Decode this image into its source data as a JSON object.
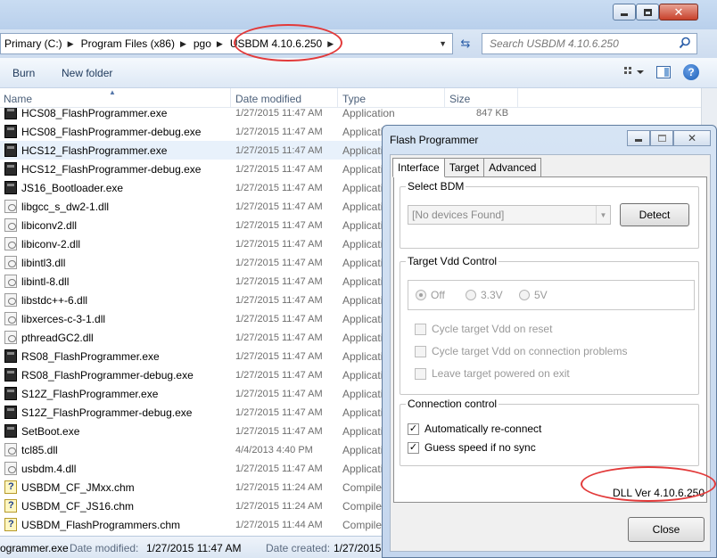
{
  "address": {
    "crumbs": [
      "Primary (C:)",
      "Program Files (x86)",
      "pgo",
      "USBDM 4.10.6.250"
    ],
    "search_placeholder": "Search USBDM 4.10.6.250"
  },
  "toolbar": {
    "burn": "Burn",
    "new_folder": "New folder"
  },
  "columns": {
    "name": "Name",
    "date": "Date modified",
    "type": "Type",
    "size": "Size"
  },
  "files": [
    {
      "name": "HCS08_FlashProgrammer.exe",
      "date": "1/27/2015 11:47 AM",
      "type": "Application",
      "size": "847 KB",
      "icon": "exe-icon"
    },
    {
      "name": "HCS08_FlashProgrammer-debug.exe",
      "date": "1/27/2015 11:47 AM",
      "type": "Applicati",
      "size": "",
      "icon": "exe-icon"
    },
    {
      "name": "HCS12_FlashProgrammer.exe",
      "date": "1/27/2015 11:47 AM",
      "type": "Applicati",
      "size": "",
      "icon": "exe-icon"
    },
    {
      "name": "HCS12_FlashProgrammer-debug.exe",
      "date": "1/27/2015 11:47 AM",
      "type": "Applicati",
      "size": "",
      "icon": "exe-icon"
    },
    {
      "name": "JS16_Bootloader.exe",
      "date": "1/27/2015 11:47 AM",
      "type": "Applicati",
      "size": "",
      "icon": "exe-icon"
    },
    {
      "name": "libgcc_s_dw2-1.dll",
      "date": "1/27/2015 11:47 AM",
      "type": "Applicati",
      "size": "",
      "icon": "dll-icon"
    },
    {
      "name": "libiconv2.dll",
      "date": "1/27/2015 11:47 AM",
      "type": "Applicati",
      "size": "",
      "icon": "dll-icon"
    },
    {
      "name": "libiconv-2.dll",
      "date": "1/27/2015 11:47 AM",
      "type": "Applicati",
      "size": "",
      "icon": "dll-icon"
    },
    {
      "name": "libintl3.dll",
      "date": "1/27/2015 11:47 AM",
      "type": "Applicati",
      "size": "",
      "icon": "dll-icon"
    },
    {
      "name": "libintl-8.dll",
      "date": "1/27/2015 11:47 AM",
      "type": "Applicati",
      "size": "",
      "icon": "dll-icon"
    },
    {
      "name": "libstdc++-6.dll",
      "date": "1/27/2015 11:47 AM",
      "type": "Applicati",
      "size": "",
      "icon": "dll-icon"
    },
    {
      "name": "libxerces-c-3-1.dll",
      "date": "1/27/2015 11:47 AM",
      "type": "Applicati",
      "size": "",
      "icon": "dll-icon"
    },
    {
      "name": "pthreadGC2.dll",
      "date": "1/27/2015 11:47 AM",
      "type": "Applicati",
      "size": "",
      "icon": "dll-icon"
    },
    {
      "name": "RS08_FlashProgrammer.exe",
      "date": "1/27/2015 11:47 AM",
      "type": "Applicati",
      "size": "",
      "icon": "exe-icon"
    },
    {
      "name": "RS08_FlashProgrammer-debug.exe",
      "date": "1/27/2015 11:47 AM",
      "type": "Applicati",
      "size": "",
      "icon": "exe-icon"
    },
    {
      "name": "S12Z_FlashProgrammer.exe",
      "date": "1/27/2015 11:47 AM",
      "type": "Applicati",
      "size": "",
      "icon": "exe-icon"
    },
    {
      "name": "S12Z_FlashProgrammer-debug.exe",
      "date": "1/27/2015 11:47 AM",
      "type": "Applicati",
      "size": "",
      "icon": "exe-icon"
    },
    {
      "name": "SetBoot.exe",
      "date": "1/27/2015 11:47 AM",
      "type": "Applicati",
      "size": "",
      "icon": "exe-icon"
    },
    {
      "name": "tcl85.dll",
      "date": "4/4/2013 4:40 PM",
      "type": "Applicati",
      "size": "",
      "icon": "dll-icon"
    },
    {
      "name": "usbdm.4.dll",
      "date": "1/27/2015 11:47 AM",
      "type": "Applicati",
      "size": "",
      "icon": "dll-icon"
    },
    {
      "name": "USBDM_CF_JMxx.chm",
      "date": "1/27/2015 11:24 AM",
      "type": "Compile",
      "size": "",
      "icon": "chm-icon"
    },
    {
      "name": "USBDM_CF_JS16.chm",
      "date": "1/27/2015 11:24 AM",
      "type": "Compile",
      "size": "",
      "icon": "chm-icon"
    },
    {
      "name": "USBDM_FlashProgrammers.chm",
      "date": "1/27/2015 11:44 AM",
      "type": "Compile",
      "size": "",
      "icon": "chm-icon"
    }
  ],
  "details": {
    "name": "ogrammer.exe",
    "modified_label": "Date modified:",
    "modified_value": "1/27/2015 11:47 AM",
    "created_label": "Date created:",
    "created_value": "1/27/2015"
  },
  "dialog": {
    "title": "Flash Programmer",
    "tabs": [
      "Interface",
      "Target",
      "Advanced"
    ],
    "select_bdm": {
      "label": "Select BDM",
      "combo_value": "[No devices Found]",
      "detect_button": "Detect"
    },
    "vdd": {
      "label": "Target Vdd Control",
      "options": [
        "Off",
        "3.3V",
        "5V"
      ],
      "selected": "Off",
      "checks": [
        "Cycle target Vdd on reset",
        "Cycle target Vdd on connection problems",
        "Leave target powered on exit"
      ]
    },
    "connection": {
      "label": "Connection control",
      "checks": [
        {
          "label": "Automatically re-connect",
          "checked": true
        },
        {
          "label": "Guess speed if no sync",
          "checked": true
        }
      ]
    },
    "version": "DLL Ver 4.10.6.250",
    "close_button": "Close"
  },
  "colors": {
    "annotation": "#e23a3a",
    "selected_row": "#e8f1fb"
  }
}
